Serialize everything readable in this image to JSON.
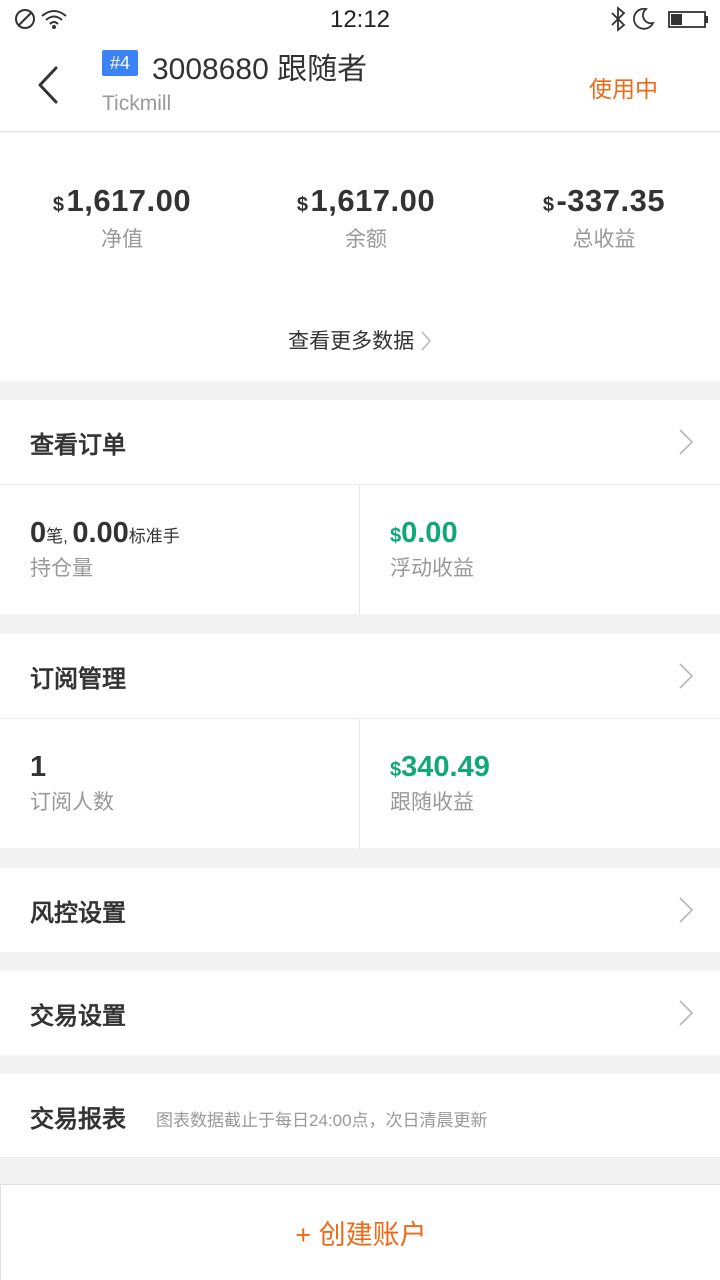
{
  "status_bar": {
    "time": "12:12",
    "icons": [
      "no-sim-icon",
      "wifi-icon",
      "bluetooth-icon",
      "moon-icon",
      "battery-icon"
    ]
  },
  "header": {
    "badge": "#4",
    "title": "3008680 跟随者",
    "broker": "Tickmill",
    "status": "使用中"
  },
  "stats": {
    "currency": "$",
    "items": [
      {
        "value": "1,617.00",
        "label": "净值"
      },
      {
        "value": "1,617.00",
        "label": "余额"
      },
      {
        "value": "-337.35",
        "label": "总收益"
      }
    ],
    "more_link": "查看更多数据"
  },
  "orders": {
    "title": "查看订单",
    "positions_count": "0",
    "positions_unit": "笔,",
    "lots": "0.00",
    "lots_unit": "标准手",
    "positions_label": "持仓量",
    "floating_currency": "$",
    "floating_value": "0.00",
    "floating_label": "浮动收益"
  },
  "subscription": {
    "title": "订阅管理",
    "subscribers": "1",
    "subscribers_label": "订阅人数",
    "follow_currency": "$",
    "follow_value": "340.49",
    "follow_label": "跟随收益"
  },
  "risk": {
    "title": "风控设置"
  },
  "trade_settings": {
    "title": "交易设置"
  },
  "report": {
    "title": "交易报表",
    "note": "图表数据截止于每日24:00点，次日清晨更新"
  },
  "create_account": {
    "label": "+ 创建账户"
  },
  "colors": {
    "accent": "#ee6a17",
    "positive": "#11a878",
    "badge": "#3b82f6",
    "background": "#f3f3f3"
  }
}
